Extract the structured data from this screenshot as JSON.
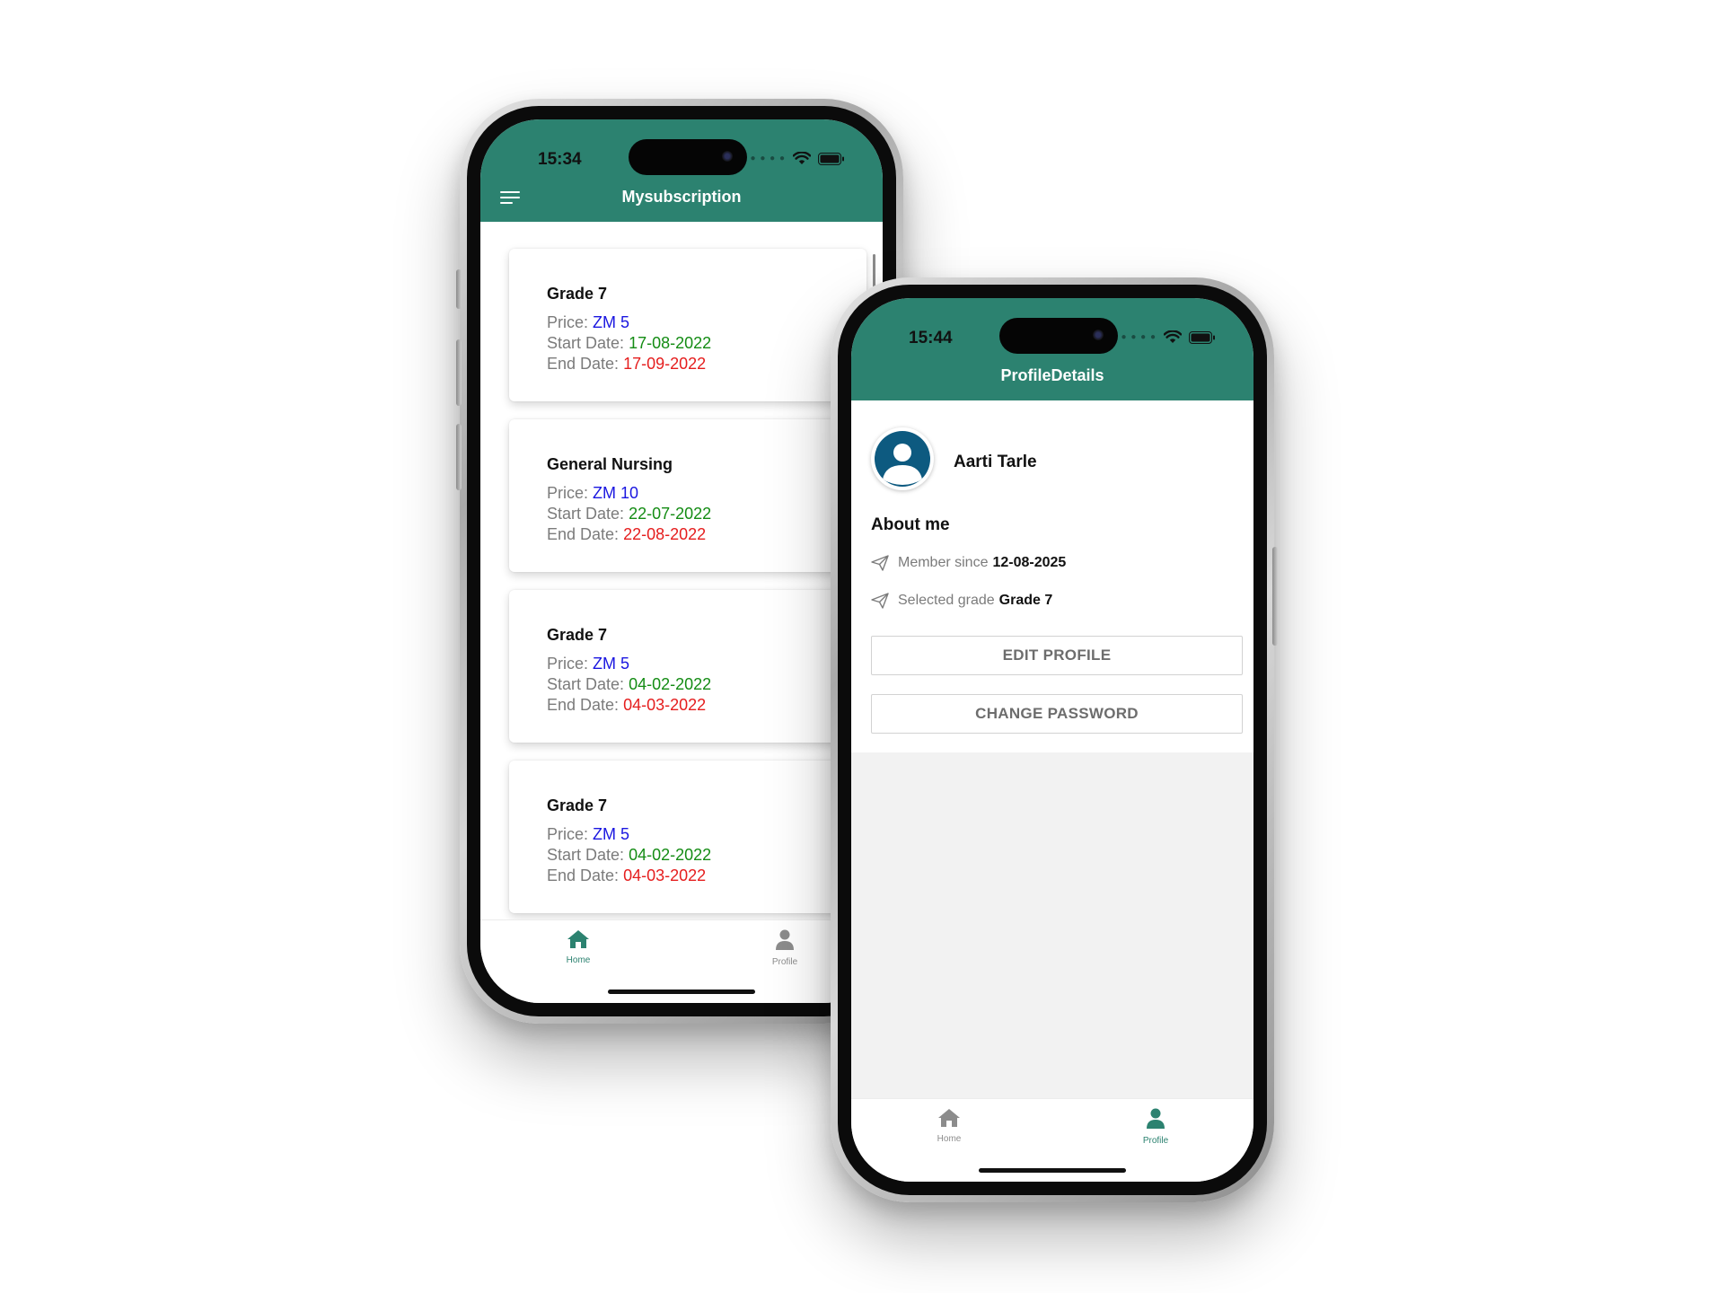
{
  "left_phone": {
    "status_time": "15:34",
    "title": "Mysubscription",
    "price_label": "Price:",
    "start_label": "Start Date:",
    "end_label": "End Date:",
    "subscriptions": [
      {
        "name": "Grade 7",
        "price": "ZM 5",
        "start": "17-08-2022",
        "end": "17-09-2022"
      },
      {
        "name": "General Nursing",
        "price": "ZM 10",
        "start": "22-07-2022",
        "end": "22-08-2022"
      },
      {
        "name": "Grade 7",
        "price": "ZM 5",
        "start": "04-02-2022",
        "end": "04-03-2022"
      },
      {
        "name": "Grade 7",
        "price": "ZM 5",
        "start": "04-02-2022",
        "end": "04-03-2022"
      }
    ],
    "tabs": [
      {
        "label": "Home",
        "icon": "home-icon",
        "active": true
      },
      {
        "label": "Profile",
        "icon": "user-icon",
        "active": false
      }
    ]
  },
  "right_phone": {
    "status_time": "15:44",
    "title": "ProfileDetails",
    "user_name": "Aarti Tarle",
    "about_heading": "About me",
    "member_since_label": "Member since",
    "member_since_value": "12-08-2025",
    "selected_grade_label": "Selected grade",
    "selected_grade_value": "Grade 7",
    "edit_profile_label": "EDIT PROFILE",
    "change_password_label": "CHANGE PASSWORD",
    "tabs": [
      {
        "label": "Home",
        "icon": "home-icon",
        "active": false
      },
      {
        "label": "Profile",
        "icon": "user-icon",
        "active": true
      }
    ]
  },
  "colors": {
    "brand": "#2c8270",
    "price": "#1a16e0",
    "start_date": "#148c14",
    "end_date": "#e51d1d",
    "avatar": "#0d5a80"
  }
}
